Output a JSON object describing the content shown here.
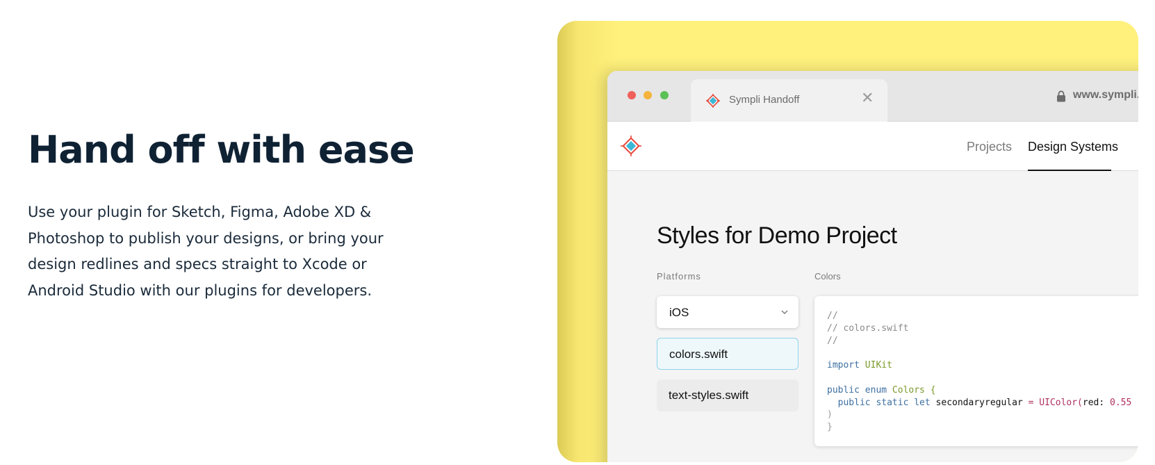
{
  "hero": {
    "title": "Hand off with ease",
    "description": "Use your plugin for Sketch, Figma, Adobe XD & Photoshop to publish your designs, or bring your design redlines and specs straight to Xcode or Android Studio with our plugins for developers."
  },
  "browser": {
    "tab_title": "Sympli Handoff",
    "tab_close": "✕",
    "url": "www.sympli.io"
  },
  "app": {
    "nav": {
      "projects": "Projects",
      "design_systems": "Design Systems",
      "active": "Design Systems"
    },
    "page_title": "Styles for Demo Project",
    "platforms_label": "Platforms",
    "colors_label": "Colors",
    "platform_selected": "iOS",
    "files": [
      "colors.swift",
      "text-styles.swift"
    ],
    "active_file": "colors.swift",
    "code": {
      "l1": "//",
      "l2": "// colors.swift",
      "l3": "//",
      "import_kw": "import",
      "import_mod": "UIKit",
      "enum_kw": "public enum",
      "enum_name": "Colors",
      "enum_open": "{",
      "prop_kw": "public static let",
      "prop_name": "secondaryregular",
      "prop_eq": "=",
      "prop_call": "UIColor(",
      "prop_param": "red",
      "prop_colon": ":",
      "prop_val": "0.55",
      "close_paren": ")",
      "close_brace": "}"
    }
  },
  "colors": {
    "showcase_yellow": "#fff17c",
    "title_navy": "#0f2234",
    "active_file_bg": "#eef8fb",
    "active_file_border": "#8fd3ec",
    "logo_red": "#e8493b",
    "logo_cyan": "#3bb8d6"
  }
}
